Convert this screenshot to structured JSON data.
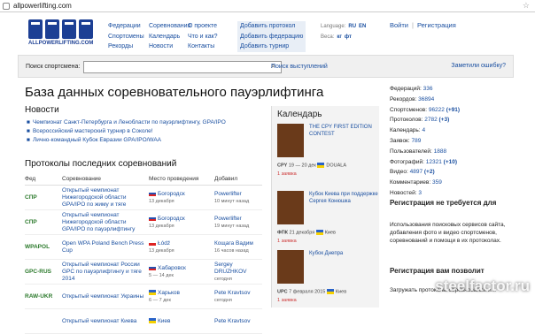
{
  "address": {
    "url": "allpowerlifting.com"
  },
  "logo": {
    "text": "ALLPOWERLIFTING.COM"
  },
  "nav": {
    "col1": [
      "Федерации",
      "Спортсмены",
      "Рекорды"
    ],
    "col2": [
      "Соревнования",
      "Календарь",
      "Новости"
    ],
    "col3": [
      "О проекте",
      "Что и как?",
      "Контакты"
    ],
    "col4": [
      "Добавить протокол",
      "Добавить федерацию",
      "Добавить турнир"
    ]
  },
  "lang": {
    "label": "Language:",
    "ru": "RU",
    "en": "EN",
    "weights_label": "Веса:",
    "kg": "кг",
    "lb": "фт"
  },
  "auth": {
    "login": "Войти",
    "register": "Регистрация"
  },
  "search": {
    "label": "Поиск спортсмена:",
    "link": "Поиск выступлений",
    "mistake": "Заметили ошибку?"
  },
  "title": "База данных соревновательного пауэрлифтинга",
  "news": {
    "heading": "Новости",
    "items": [
      "Чемпионат Санкт-Петербурга и Ленобласти по пауэрлифтингу, GPA/IPO",
      "Всероссийский мастерский турнир в Соколе!",
      "Лично-командный Кубок Евразии GPA/IPO/WAA"
    ]
  },
  "protocols": {
    "heading": "Протоколы последних соревнований",
    "headers": [
      "Фед",
      "Соревнование",
      "Место проведения",
      "Добавил"
    ],
    "rows": [
      {
        "fed": "СПР",
        "comp": "Открытый чемпионат Нижегородской области GPA/IPO по жиму и тяге",
        "city": "Богородск",
        "date": "13 декабря",
        "by": "Powerlifter",
        "when": "10 минут назад",
        "flag": "ru"
      },
      {
        "fed": "СПР",
        "comp": "Открытый чемпионат Нижегородской области GPA/IPO по пауэрлифтингу",
        "city": "Богородск",
        "date": "13 декабря",
        "by": "Powerlifter",
        "when": "19 минут назад",
        "flag": "ru"
      },
      {
        "fed": "WPAPOL",
        "comp": "Open WPA Poland Bench Press Cup",
        "city": "Łódź",
        "date": "13 декабря",
        "by": "Кощага Вадим",
        "when": "16 часов назад",
        "flag": "pl"
      },
      {
        "fed": "GPC-RUS",
        "comp": "Открытый чемпионат России GPC по пауэрлифтингу и тяге 2014",
        "city": "Хабаровск",
        "date": "5 — 14 дек",
        "by": "Sergey DRUZHKOV",
        "when": "сегодня",
        "flag": "ru"
      },
      {
        "fed": "RAW-UKR",
        "comp": "Открытый чемпионат Украины",
        "city": "Харьков",
        "date": "6 — 7 дек",
        "by": "Pete Kravtsov",
        "when": "сегодня",
        "flag": "ua"
      },
      {
        "fed": "",
        "comp": "Открытый чемпионат Киева",
        "city": "Киев",
        "date": "",
        "by": "Pete Kravtsov",
        "when": "",
        "flag": "ua"
      }
    ]
  },
  "calendar": {
    "heading": "Календарь",
    "events": [
      {
        "title": "THE CPY FIRST EDITION CONTEST",
        "fed": "CPY",
        "dates": "19 — 20 дек",
        "place": "DOUALA",
        "count": "1 заявка"
      },
      {
        "title": "Кубок Киева при поддержке Сергея Конюшка",
        "fed": "ФПК",
        "dates": "21 декабря",
        "place": "Киев",
        "count": "1 заявка"
      },
      {
        "title": "Кубок Днепра",
        "fed": "UPC",
        "dates": "7 февраля 2015",
        "place": "Киев",
        "count": "1 заявка"
      }
    ]
  },
  "stats": [
    {
      "label": "Федераций:",
      "value": "336",
      "delta": ""
    },
    {
      "label": "Рекордов:",
      "value": "36894",
      "delta": ""
    },
    {
      "label": "Спортсменов:",
      "value": "96222",
      "delta": "(+91)"
    },
    {
      "label": "Протоколов:",
      "value": "2782",
      "delta": "(+3)"
    },
    {
      "label": "Календарь:",
      "value": "4",
      "delta": ""
    },
    {
      "label": "Заявок:",
      "value": "789",
      "delta": ""
    },
    {
      "label": "Пользователей:",
      "value": "1888",
      "delta": ""
    },
    {
      "label": "Фотографий:",
      "value": "12321",
      "delta": "(+10)"
    },
    {
      "label": "Видео:",
      "value": "4897",
      "delta": "(+2)"
    },
    {
      "label": "Комментариев:",
      "value": "359",
      "delta": ""
    },
    {
      "label": "Новостей:",
      "value": "3",
      "delta": ""
    }
  ],
  "reg1": {
    "title": "Регистрация не требуется для",
    "text": "Использования поисковых сервисов сайта, добавления фото и видео спортсменов, соревнований и помощи в их протоколах."
  },
  "reg2": {
    "title": "Регистрация вам позволит",
    "text": "Загружать протоколы соревнований и..."
  },
  "watermark": "steelfactor.ru"
}
